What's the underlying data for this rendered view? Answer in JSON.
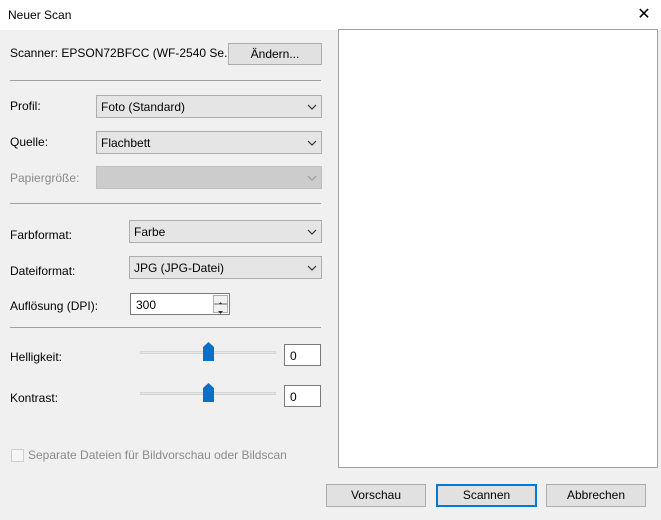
{
  "window": {
    "title": "Neuer Scan",
    "close": "✕"
  },
  "scanner": {
    "label": "Scanner: EPSON72BFCC (WF-2540 Se...",
    "change_button": "Ändern..."
  },
  "source_group": {
    "profile": {
      "label": "Profil:",
      "value": "Foto (Standard)"
    },
    "source": {
      "label": "Quelle:",
      "value": "Flachbett"
    },
    "paper_size": {
      "label": "Papiergröße:",
      "value": ""
    }
  },
  "format_group": {
    "color_format": {
      "label": "Farbformat:",
      "value": "Farbe"
    },
    "file_format": {
      "label": "Dateiformat:",
      "value": "JPG (JPG-Datei)"
    },
    "resolution": {
      "label": "Auflösung (DPI):",
      "value": "300"
    }
  },
  "adjust_group": {
    "brightness": {
      "label": "Helligkeit:",
      "value": "0",
      "level": 0.5
    },
    "contrast": {
      "label": "Kontrast:",
      "value": "0",
      "level": 0.5
    }
  },
  "separate_files": {
    "label": "Separate Dateien für Bildvorschau oder Bildscan",
    "checked": false
  },
  "buttons": {
    "preview": "Vorschau",
    "scan": "Scannen",
    "cancel": "Abbrechen"
  },
  "colors": {
    "accent": "#0078d7",
    "slider_thumb": "#0a6fc9"
  }
}
